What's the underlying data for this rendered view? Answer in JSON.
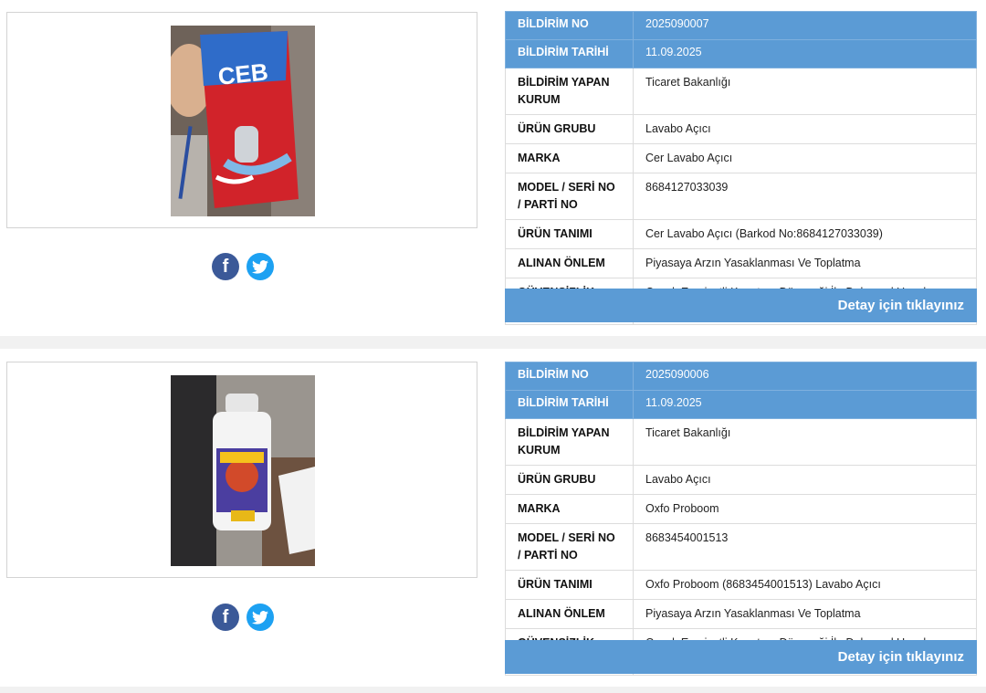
{
  "records": [
    {
      "fields": [
        {
          "label": "BİLDİRİM NO",
          "value": "2025090007"
        },
        {
          "label": "BİLDİRİM TARİHİ",
          "value": "11.09.2025"
        },
        {
          "label": "BİLDİRİM YAPAN KURUM",
          "value": "Ticaret Bakanlığı"
        },
        {
          "label": "ÜRÜN GRUBU",
          "value": "Lavabo Açıcı"
        },
        {
          "label": "MARKA",
          "value": "Cer Lavabo Açıcı"
        },
        {
          "label": "MODEL / SERİ NO / PARTİ NO",
          "value": "8684127033039"
        },
        {
          "label": "ÜRÜN TANIMI",
          "value": "Cer Lavabo Açıcı (Barkod No:8684127033039)"
        },
        {
          "label": "ALINAN ÖNLEM",
          "value": "Piyasaya Arzın Yasaklanması Ve Toplatma"
        },
        {
          "label": "GÜVENSİZLİK NEDENİ",
          "value": "Çocuk Emniyetli Kapatma Düzeneği İle Dokunsal Uyanların Bulunmaması"
        }
      ],
      "detail_label": "Detay için tıklayınız",
      "photo_brand_text": "CEB"
    },
    {
      "fields": [
        {
          "label": "BİLDİRİM NO",
          "value": "2025090006"
        },
        {
          "label": "BİLDİRİM TARİHİ",
          "value": "11.09.2025"
        },
        {
          "label": "BİLDİRİM YAPAN KURUM",
          "value": "Ticaret Bakanlığı"
        },
        {
          "label": "ÜRÜN GRUBU",
          "value": "Lavabo Açıcı"
        },
        {
          "label": "MARKA",
          "value": "Oxfo Proboom"
        },
        {
          "label": "MODEL / SERİ NO / PARTİ NO",
          "value": "8683454001513"
        },
        {
          "label": "ÜRÜN TANIMI",
          "value": "Oxfo Proboom (8683454001513) Lavabo Açıcı"
        },
        {
          "label": "ALINAN ÖNLEM",
          "value": "Piyasaya Arzın Yasaklanması Ve Toplatma"
        },
        {
          "label": "GÜVENSİZLİK NEDENİ",
          "value": "Çocuk Emniyetli Kapatma Düzeneği İle Dokunsal Uyanların Bulunmaması"
        }
      ],
      "detail_label": "Detay için tıklayınız"
    }
  ],
  "social": {
    "facebook_icon": "facebook-icon",
    "twitter_icon": "twitter-icon",
    "facebook_glyph": "f"
  },
  "colors": {
    "header_blue": "#5b9bd5",
    "facebook": "#3b5998",
    "twitter": "#1da1f2"
  }
}
